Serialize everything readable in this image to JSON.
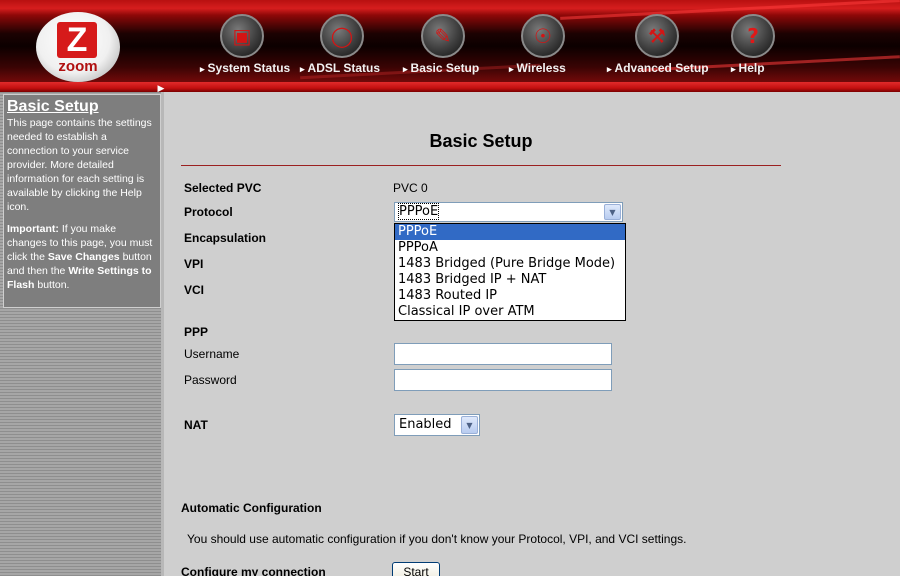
{
  "brand": {
    "logo_text": "zoom",
    "logo_letter": "Z"
  },
  "nav": [
    {
      "label": "System Status",
      "icon": "system-status-icon"
    },
    {
      "label": "ADSL Status",
      "icon": "magnifier-icon"
    },
    {
      "label": "Basic Setup",
      "icon": "basic-setup-icon"
    },
    {
      "label": "Wireless",
      "icon": "wireless-icon"
    },
    {
      "label": "Advanced Setup",
      "icon": "wrench-icon"
    },
    {
      "label": "Help",
      "icon": "help-icon"
    }
  ],
  "sidebar": {
    "title": "Basic Setup",
    "description": "This page contains the settings needed to establish a connection to your service provider. More detailed information for each setting is available by clicking the Help icon.",
    "important_label": "Important:",
    "important_text_1": " If you make changes to this page, you must click the ",
    "save_changes": "Save Changes",
    "important_text_2": " button and then the ",
    "write_settings": "Write Settings to Flash",
    "important_text_3": " button."
  },
  "page": {
    "title": "Basic Setup"
  },
  "form": {
    "selected_pvc_label": "Selected PVC",
    "selected_pvc_value": "PVC 0",
    "protocol_label": "Protocol",
    "protocol_value": "PPPoE",
    "protocol_options": [
      "PPPoE",
      "PPPoA",
      "1483 Bridged (Pure Bridge Mode)",
      "1483 Bridged IP + NAT",
      "1483 Routed IP",
      "Classical IP over ATM"
    ],
    "protocol_highlighted": "PPPoE",
    "encapsulation_label": "Encapsulation",
    "vpi_label": "VPI",
    "vci_label": "VCI",
    "ppp_label": "PPP",
    "username_label": "Username",
    "username_value": "",
    "password_label": "Password",
    "password_value": "",
    "nat_label": "NAT",
    "nat_value": "Enabled"
  },
  "auto_config": {
    "heading": "Automatic Configuration",
    "description": "You should use automatic configuration if you don't know your Protocol, VPI, and VCI settings.",
    "configure_label": "Configure my connection",
    "start_button": "Start"
  },
  "colors": {
    "brand_red": "#d61a1a",
    "header_dark": "#0c0000",
    "selection_blue": "#316ac5",
    "rule_red": "#9b2020"
  }
}
